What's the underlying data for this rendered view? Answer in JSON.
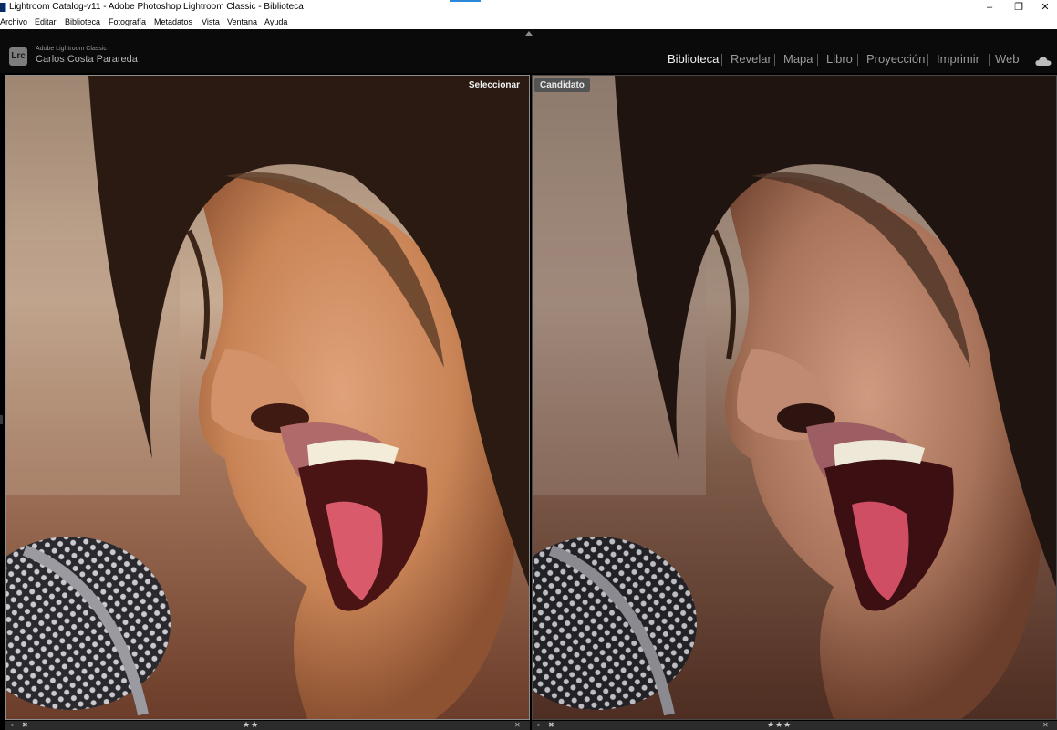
{
  "window": {
    "title": "Lightroom Catalog-v11 - Adobe Photoshop Lightroom Classic - Biblioteca",
    "controls": {
      "minimize": "–",
      "restore": "❐",
      "close": "✕"
    }
  },
  "menu": [
    "Archivo",
    "Editar",
    "Biblioteca",
    "Fotografía",
    "Metadatos",
    "Vista",
    "Ventana",
    "Ayuda"
  ],
  "identity": {
    "badge": "Lrc",
    "product": "Adobe Lightroom Classic",
    "user": "Carlos Costa Parareda"
  },
  "modules": [
    {
      "label": "Biblioteca",
      "active": true
    },
    {
      "label": "Revelar",
      "active": false
    },
    {
      "label": "Mapa",
      "active": false
    },
    {
      "label": "Libro",
      "active": false
    },
    {
      "label": "Proyección",
      "active": false
    },
    {
      "label": "Imprimir",
      "active": false
    },
    {
      "label": "Web",
      "active": false
    }
  ],
  "compare": {
    "left_label": "Seleccionar",
    "right_label": "Candidato",
    "left_rating": "★★ · · ·",
    "right_rating": "★★★ · ·"
  },
  "colors": {
    "active_module": "#f0f0f0",
    "inactive_module": "#9a9a9a",
    "select_border": "#8d8d8d"
  },
  "icons": [
    "lightroom-logo-icon",
    "cloud-sync-icon",
    "collapse-panel-arrow-icon",
    "flag-icon",
    "reject-icon",
    "close-icon"
  ]
}
